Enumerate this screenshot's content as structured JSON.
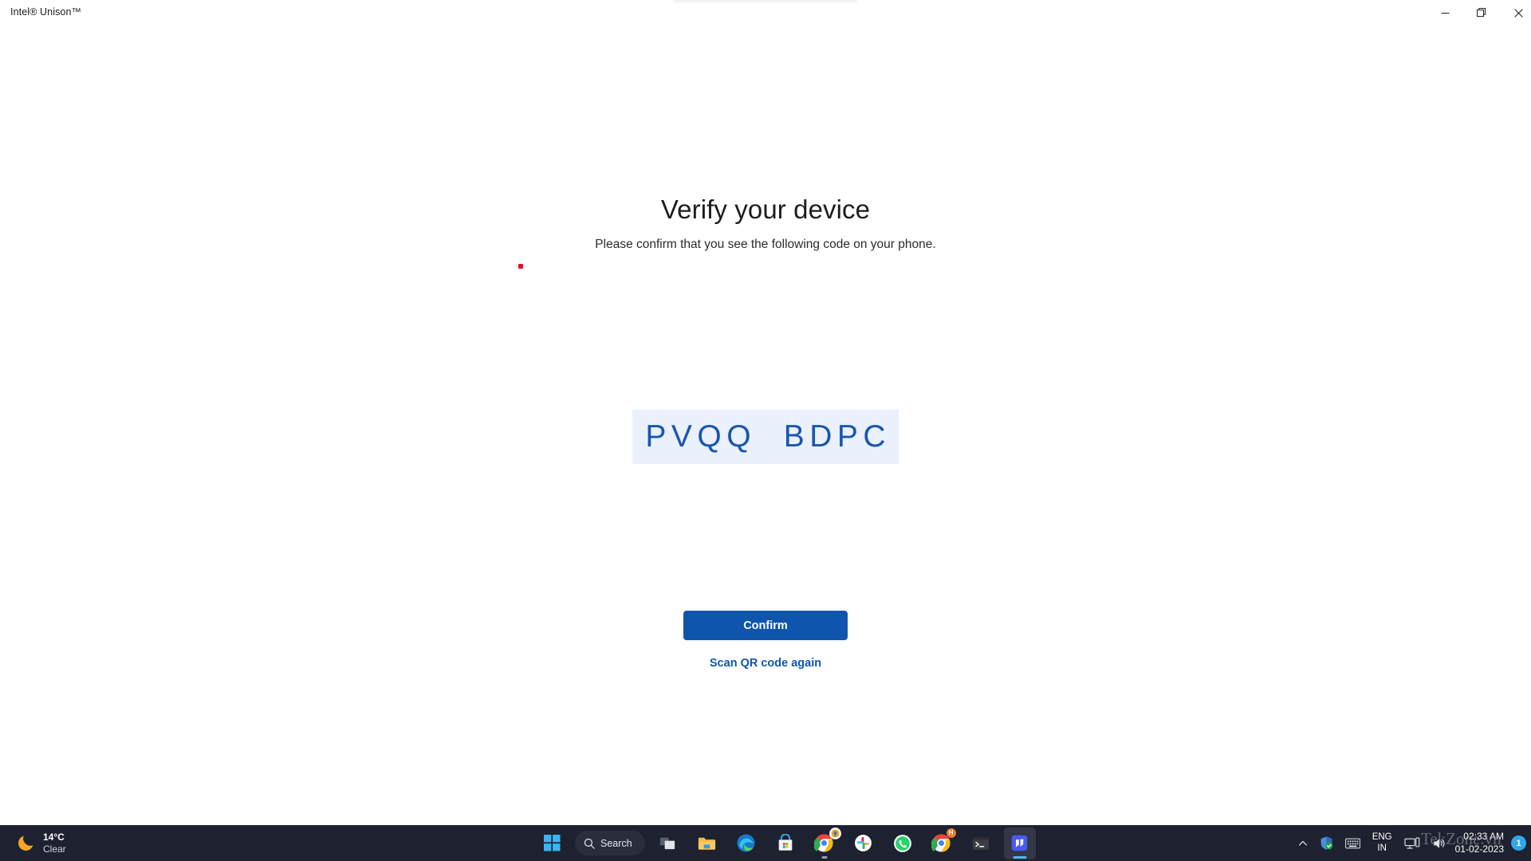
{
  "window": {
    "title": "Intel® Unison™",
    "controls": {
      "minimize": "minimize-button",
      "maximize": "restore-button",
      "close": "close-button"
    }
  },
  "main": {
    "heading": "Verify your device",
    "subheading": "Please confirm that you see the following code on your phone.",
    "verification_code": "PVQQ  BDPC",
    "confirm_label": "Confirm",
    "scan_again_label": "Scan QR code again",
    "colors": {
      "code_background": "#eaf1fd",
      "code_text": "#1a56b0",
      "primary_button": "#0f55ad",
      "link": "#0f55ad",
      "marker_dot": "#e81123"
    }
  },
  "taskbar": {
    "background": "#1e2130",
    "weather": {
      "icon": "moon-icon",
      "temperature": "14°C",
      "condition": "Clear"
    },
    "search": {
      "icon": "search-icon",
      "label": "Search"
    },
    "items": [
      {
        "name": "start-button",
        "icon": "windows-logo-icon",
        "running": false
      },
      {
        "name": "task-view-button",
        "icon": "task-view-icon",
        "running": false
      },
      {
        "name": "file-explorer",
        "icon": "folder-icon",
        "running": false
      },
      {
        "name": "microsoft-edge",
        "icon": "edge-icon",
        "running": false
      },
      {
        "name": "microsoft-store",
        "icon": "store-icon",
        "running": false
      },
      {
        "name": "google-chrome",
        "icon": "chrome-icon",
        "running": true,
        "badge": "update"
      },
      {
        "name": "slack",
        "icon": "slack-icon",
        "running": false
      },
      {
        "name": "whatsapp",
        "icon": "whatsapp-icon",
        "running": false
      },
      {
        "name": "chrome-profile",
        "icon": "chrome-icon",
        "running": false,
        "badge": "H"
      },
      {
        "name": "windows-terminal",
        "icon": "terminal-icon",
        "running": false
      },
      {
        "name": "intel-unison",
        "icon": "intel-unison-icon",
        "running": true,
        "active": true
      }
    ],
    "tray": {
      "overflow_icon": "chevron-up-icon",
      "defender_icon": "shield-check-icon",
      "ime_icon": "keyboard-icon",
      "language_primary": "ENG",
      "language_secondary": "IN",
      "network_icon": "network-display-icon",
      "volume_icon": "speaker-icon",
      "time": "02:33 AM",
      "date": "01-02-2023",
      "notification_count": "1"
    }
  },
  "watermark": "TekZone.vn"
}
